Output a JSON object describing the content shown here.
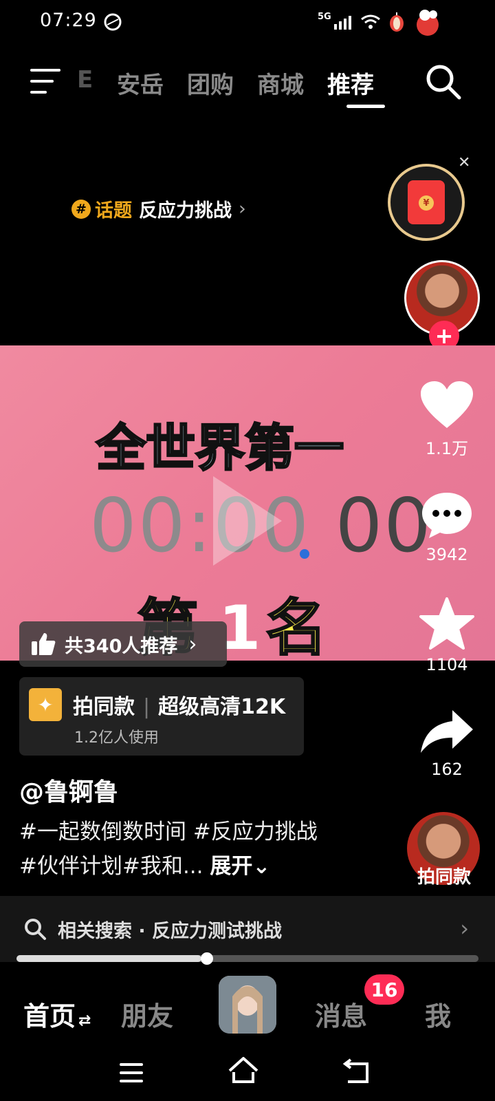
{
  "status_bar": {
    "time": "07:29",
    "network": "5G"
  },
  "top_nav": {
    "tabs": [
      {
        "label": "E",
        "partial": true
      },
      {
        "label": "安岳"
      },
      {
        "label": "团购"
      },
      {
        "label": "商城"
      },
      {
        "label": "推荐",
        "active": true
      }
    ]
  },
  "topic": {
    "label": "话题",
    "name": "反应力挑战"
  },
  "video": {
    "title": "全世界第一",
    "timer_gray": "00:00",
    "timer_dark": "00",
    "rank_prefix": "第",
    "rank_number": "1",
    "rank_suffix": "名"
  },
  "actions": {
    "likes": "1.1万",
    "comments": "3942",
    "favorites": "1104",
    "shares": "162"
  },
  "recommend": {
    "text": "共340人推荐"
  },
  "same_style": {
    "title": "拍同款",
    "effect": "超级高清12K",
    "users": "1.2亿人使用",
    "avatar_label": "拍同款"
  },
  "author": "@鲁锕鲁",
  "caption": {
    "text": "#一起数倒数时间 #反应力挑战 #伙伴计划#我和...",
    "expand": "展开"
  },
  "related_search": {
    "text": "相关搜索 · 反应力测试挑战"
  },
  "progress": {
    "fraction": 0.4
  },
  "bottom_nav": {
    "home": "首页",
    "friends": "朋友",
    "messages": "消息",
    "messages_badge": "16",
    "me": "我"
  },
  "colors": {
    "accent": "#fe2c55",
    "topic": "#f0a81c"
  }
}
